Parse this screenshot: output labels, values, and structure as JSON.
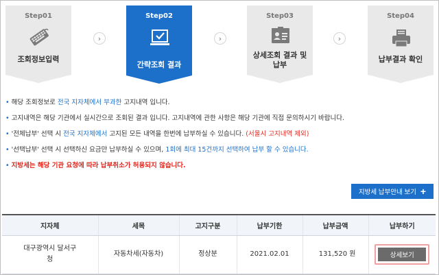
{
  "steps": [
    {
      "no": "Step01",
      "label": "조회정보입력",
      "icon": "keyboard-icon",
      "active": false
    },
    {
      "no": "Step02",
      "label": "간략조회 결과",
      "icon": "monitor-check-icon",
      "active": true
    },
    {
      "no": "Step03",
      "label": "상세조회 결과 및 납부",
      "label_line1": "상세조회 결과 및",
      "label_line2": "납부",
      "icon": "id-card-icon",
      "active": false
    },
    {
      "no": "Step04",
      "label": "납부결과 확인",
      "icon": "printer-icon",
      "active": false
    }
  ],
  "notes": {
    "n1": {
      "pre": "해당 조회정보로 ",
      "hl1": "전국 지자체에서 부과한",
      "post": " 고지내역 입니다."
    },
    "n2": {
      "text": "고지내역은 해당 기관에서 실시간으로 조회된 결과 입니다. 고지내역에 관한 사항은 해당 기관에 직접 문의하시기 바랍니다."
    },
    "n3": {
      "pre": "'전체납부' 선택 시 ",
      "hl1": "전국 지자체에서",
      "mid": " 고지된 모든 내역을 한번에 납부하실 수 있습니다. ",
      "hl2": "(서울시 고지내역 제외)"
    },
    "n4": {
      "pre": "'선택납부' 선택 시 선택하신 요금만 납부하실 수 있으며, ",
      "hl1": "1회에 최대 15건까지 선택하여 납부 할 수 있습니다."
    },
    "n5": {
      "text": "지방세는 해당 기관 요청에 따라 납부취소가 허용되지 않습니다."
    }
  },
  "guide_button": {
    "label": "지방세 납부안내 보기",
    "icon": "plus-icon"
  },
  "table": {
    "headers": [
      "지자체",
      "세목",
      "고지구분",
      "납부기한",
      "납부금액",
      "납부하기"
    ],
    "rows": [
      {
        "region_line1": "대구광역시 달서구",
        "region_line2": "청",
        "tax": "자동차세(자동차)",
        "type": "정상분",
        "due": "2021.02.01",
        "amount": "131,520 원",
        "action": "상세보기"
      }
    ]
  },
  "colors": {
    "accent": "#1d70c9",
    "red": "#e2261d",
    "step_inactive": "#e9e9e9",
    "detail_button": "#6b6b6b"
  }
}
